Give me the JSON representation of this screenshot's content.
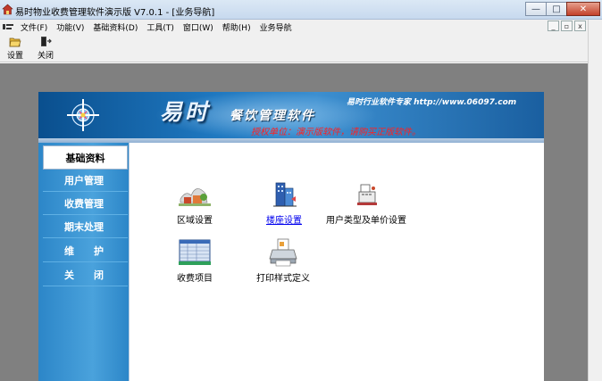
{
  "window": {
    "title": "易时物业收费管理软件演示版 V7.0.1 - [业务导航]",
    "controls": {
      "minimize": "—",
      "maximize": "□",
      "close": "✕"
    }
  },
  "menu": {
    "items": [
      "文件(F)",
      "功能(V)",
      "基础资料(D)",
      "工具(T)",
      "窗口(W)",
      "帮助(H)",
      "业务导航"
    ],
    "mdi_controls": {
      "minimize": "_",
      "restore": "▫",
      "close": "x"
    }
  },
  "toolbar": {
    "settings_label": "设置",
    "close_label": "关闭"
  },
  "banner": {
    "brand_big": "易时",
    "brand_sub": "餐饮管理软件",
    "tagline": "易时行业软件专家 http://www.06097.com",
    "license": "授权单位：演示版软件，请购买正版软件。"
  },
  "sidebar": {
    "items": [
      {
        "label": "基础资料",
        "active": true
      },
      {
        "label": "用户管理"
      },
      {
        "label": "收费管理"
      },
      {
        "label": "期末处理"
      },
      {
        "label": "维　　护"
      },
      {
        "label": "关　　闭"
      }
    ]
  },
  "tiles": {
    "area": "区域设置",
    "building": "楼座设置",
    "usertype": "用户类型及单价设置",
    "chargeitem": "收费项目",
    "printstyle": "打印样式定义"
  },
  "colors": {
    "banner_dark": "#0a4f8e",
    "sidebar_blue": "#3a96d6",
    "license_red": "#ff2020",
    "link_blue": "#0000ee"
  }
}
